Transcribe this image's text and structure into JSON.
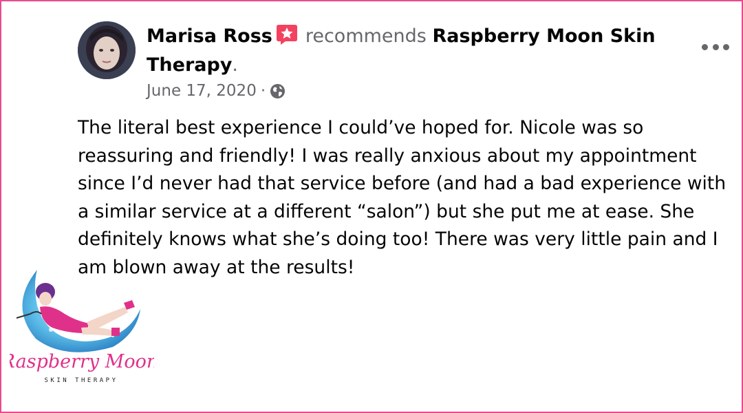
{
  "post": {
    "author": "Marisa Ross",
    "action": "recommends",
    "page_name": "Raspberry Moon Skin Therapy",
    "page_suffix": ".",
    "date": "June 17, 2020",
    "separator": "·",
    "privacy_icon": "globe-icon",
    "recommend_icon": "recommend-icon",
    "more_icon": "more-options-icon",
    "body": "The literal best experience I could’ve hoped for. Nicole was so reassuring and friendly! I was really anxious about my appointment since I’d never had that service before (and had a bad experience with a similar service at a different “salon”) but she put me at ease. She definitely knows what she’s doing too! There was very little pain and I am blown away at the results!"
  },
  "logo": {
    "title": "Raspberry Moon",
    "subtitle": "SKIN THERAPY"
  },
  "colors": {
    "frame": "#e84a8f",
    "secondary_text": "#65676b",
    "recommend_badge": "#f3425f",
    "logo_pink": "#e0318a",
    "moon_blue": "#6cc6ec"
  }
}
